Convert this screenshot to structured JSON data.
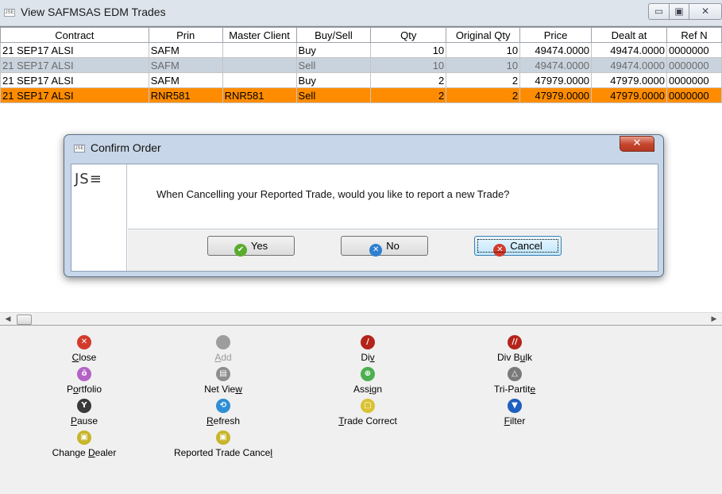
{
  "window": {
    "icon_text": "JSE",
    "title": "View SAFMSAS EDM Trades",
    "min_symbol": "▭",
    "max_symbol": "▣",
    "close_symbol": "✕"
  },
  "table": {
    "columns": [
      "Contract",
      "Prin",
      "Master Client",
      "Buy/Sell",
      "Qty",
      "Original Qty",
      "Price",
      "Dealt at",
      "Ref N"
    ],
    "rows": [
      [
        "21 SEP17 ALSI",
        "SAFM",
        "",
        "Buy",
        "10",
        "10",
        "49474.0000",
        "49474.0000",
        "0000000"
      ],
      [
        "21 SEP17 ALSI",
        "SAFM",
        "",
        "Sell",
        "10",
        "10",
        "49474.0000",
        "49474.0000",
        "0000000"
      ],
      [
        "21 SEP17 ALSI",
        "SAFM",
        "",
        "Buy",
        "2",
        "2",
        "47979.0000",
        "47979.0000",
        "0000000"
      ],
      [
        "21 SEP17 ALSI",
        "RNR581",
        "RNR581",
        "Sell",
        "2",
        "2",
        "47979.0000",
        "47979.0000",
        "0000000"
      ]
    ],
    "selected_row_color": "#c9d3de",
    "highlight_row_color": "#ff8c00"
  },
  "scrollbar": {
    "left_arrow": "◀",
    "right_arrow": "▶"
  },
  "actions": {
    "close": {
      "pre": "",
      "u": "C",
      "post": "lose",
      "icon": "close-icon",
      "glyph": "✕",
      "color": "#d33a2c"
    },
    "add": {
      "pre": "",
      "u": "A",
      "post": "dd",
      "icon": "add-icon",
      "glyph": "",
      "color": "#9d9d9d"
    },
    "div": {
      "pre": "Di",
      "u": "v",
      "post": "",
      "icon": "div-icon",
      "glyph": "/",
      "color": "#b3241b"
    },
    "div_bulk": {
      "pre": "Div B",
      "u": "u",
      "post": "lk",
      "icon": "div-bulk-icon",
      "glyph": "//",
      "color": "#b3241b"
    },
    "portfolio": {
      "pre": "P",
      "u": "o",
      "post": "rtfolio",
      "icon": "portfolio-icon",
      "glyph": "ō",
      "color": "#b462c6"
    },
    "net_view": {
      "pre": "Net Vie",
      "u": "w",
      "post": "",
      "icon": "net-view-icon",
      "glyph": "▤",
      "color": "#8e8e8e"
    },
    "assign": {
      "pre": "Ass",
      "u": "i",
      "post": "gn",
      "icon": "assign-icon",
      "glyph": "⊕",
      "color": "#4caf50"
    },
    "tri_partite": {
      "pre": "Tri-Partit",
      "u": "e",
      "post": "",
      "icon": "tri-partite-icon",
      "glyph": "△",
      "color": "#7a7a7a"
    },
    "pause": {
      "pre": "",
      "u": "P",
      "post": "ause",
      "icon": "pause-icon",
      "glyph": "Y",
      "color": "#3a3a3a"
    },
    "refresh": {
      "pre": "",
      "u": "R",
      "post": "efresh",
      "icon": "refresh-icon",
      "glyph": "⟲",
      "color": "#2d8fd5"
    },
    "trade_correct": {
      "pre": "",
      "u": "T",
      "post": "rade Correct",
      "icon": "trade-correct-icon",
      "glyph": "▢",
      "color": "#d9c233"
    },
    "filter": {
      "pre": "",
      "u": "F",
      "post": "ilter",
      "icon": "filter-icon",
      "glyph": "▼",
      "color": "#1f5fbf"
    },
    "change_dealer": {
      "pre": "Change ",
      "u": "D",
      "post": "ealer",
      "icon": "change-dealer-icon",
      "glyph": "▣",
      "color": "#c7b52a"
    },
    "reported_trade_cancel": {
      "pre": "Reported Trade Cance",
      "u": "l",
      "post": "",
      "icon": "reported-trade-cancel-icon",
      "glyph": "▣",
      "color": "#c7b52a"
    }
  },
  "dialog": {
    "icon_text": "JSE",
    "title": "Confirm Order",
    "close_symbol": "✕",
    "logo_text": "JS≡",
    "message": "When Cancelling your Reported Trade, would you like to report a new Trade?",
    "buttons": {
      "yes": {
        "label": "Yes",
        "icon": "check-icon",
        "glyph": "✔",
        "color": "#5aab2e"
      },
      "no": {
        "label": "No",
        "icon": "no-icon",
        "glyph": "✕",
        "color": "#2f7fd0"
      },
      "cancel": {
        "label": "Cancel",
        "icon": "cancel-icon",
        "glyph": "✕",
        "color": "#d33a2c"
      }
    }
  }
}
